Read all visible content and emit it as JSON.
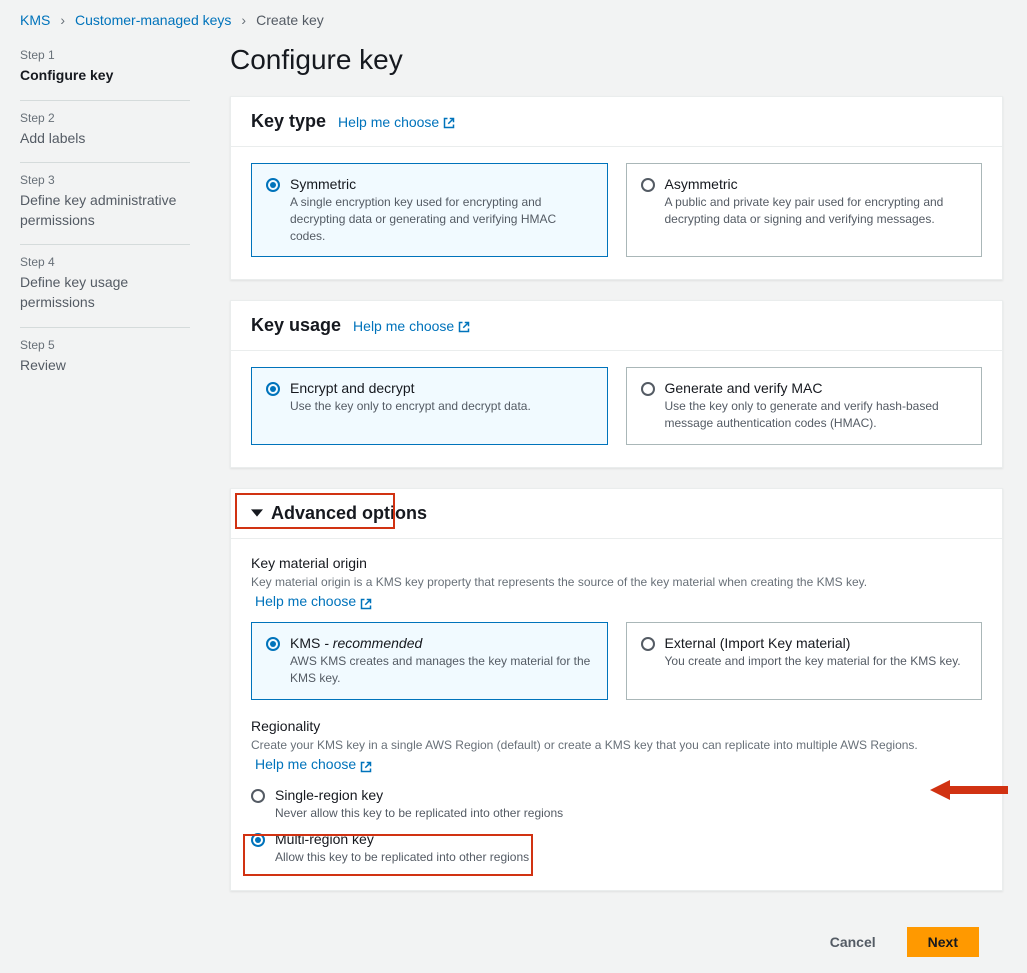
{
  "breadcrumb": {
    "kms": "KMS",
    "cmk": "Customer-managed keys",
    "create": "Create key"
  },
  "steps": {
    "s1_label": "Step 1",
    "s1_title": "Configure key",
    "s2_label": "Step 2",
    "s2_title": "Add labels",
    "s3_label": "Step 3",
    "s3_title": "Define key administrative permissions",
    "s4_label": "Step 4",
    "s4_title": "Define key usage permissions",
    "s5_label": "Step 5",
    "s5_title": "Review"
  },
  "page_title": "Configure key",
  "help_me_choose": "Help me choose",
  "key_type": {
    "heading": "Key type",
    "symmetric": {
      "title": "Symmetric",
      "desc": "A single encryption key used for encrypting and decrypting data or generating and verifying HMAC codes."
    },
    "asymmetric": {
      "title": "Asymmetric",
      "desc": "A public and private key pair used for encrypting and decrypting data or signing and verifying messages."
    }
  },
  "key_usage": {
    "heading": "Key usage",
    "encrypt": {
      "title": "Encrypt and decrypt",
      "desc": "Use the key only to encrypt and decrypt data."
    },
    "mac": {
      "title": "Generate and verify MAC",
      "desc": "Use the key only to generate and verify hash-based message authentication codes (HMAC)."
    }
  },
  "advanced": {
    "heading": "Advanced options",
    "material": {
      "title": "Key material origin",
      "help": "Key material origin is a KMS key property that represents the source of the key material when creating the KMS key.",
      "kms_title": "KMS",
      "kms_recommended": " - recommended",
      "kms_desc": "AWS KMS creates and manages the key material for the KMS key.",
      "ext_title": "External (Import Key material)",
      "ext_desc": "You create and import the key material for the KMS key."
    },
    "regionality": {
      "title": "Regionality",
      "help": "Create your KMS key in a single AWS Region (default) or create a KMS key that you can replicate into multiple AWS Regions.",
      "single_title": "Single-region key",
      "single_desc": "Never allow this key to be replicated into other regions",
      "multi_title": "Multi-region key",
      "multi_desc": "Allow this key to be replicated into other regions"
    }
  },
  "footer": {
    "cancel": "Cancel",
    "next": "Next"
  }
}
